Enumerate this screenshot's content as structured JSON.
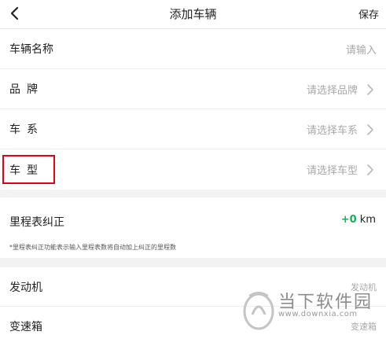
{
  "header": {
    "title": "添加车辆",
    "back_icon": "chevron-left-icon",
    "save_label": "保存"
  },
  "form": {
    "vehicle_name": {
      "label": "车辆名称",
      "placeholder": "请输入"
    },
    "brand": {
      "label": "品牌",
      "value": "请选择品牌"
    },
    "series": {
      "label": "车系",
      "value": "请选择车系"
    },
    "model": {
      "label": "车型",
      "value": "请选择车型"
    }
  },
  "odometer": {
    "label": "里程表纠正",
    "value": "+0",
    "unit": "km",
    "note": "*里程表纠正功能表示输入里程表数将自动加上纠正的里程数",
    "value_color": "#1aad5a"
  },
  "engine": {
    "label": "发动机",
    "value": "发动机"
  },
  "transmission": {
    "label": "变速箱",
    "value": "变速箱"
  },
  "highlight_color": "#e60012",
  "watermark": {
    "brand": "当下软件园",
    "site": "www.downxia.com"
  }
}
